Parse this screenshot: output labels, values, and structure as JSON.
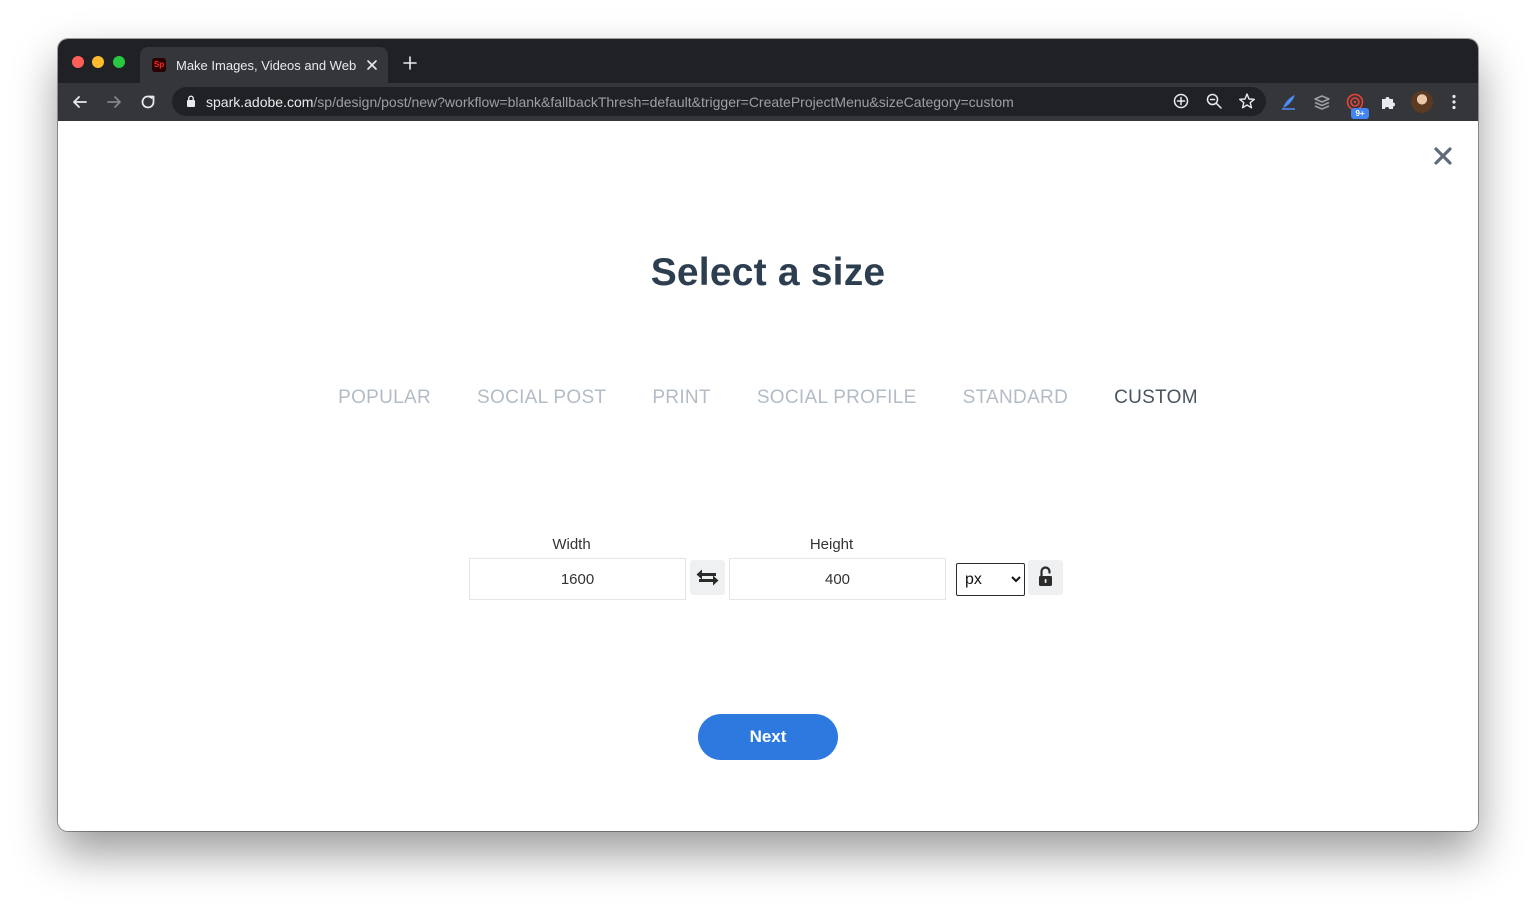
{
  "browser": {
    "tab": {
      "title": "Make Images, Videos and Web",
      "favicon_text": "Sp"
    },
    "url": {
      "host": "spark.adobe.com",
      "path": "/sp/design/post/new?workflow=blank&fallbackThresh=default&trigger=CreateProjectMenu&sizeCategory=custom"
    },
    "extension_badge": "9+"
  },
  "page": {
    "title": "Select a size",
    "tabs": [
      {
        "label": "POPULAR",
        "active": false
      },
      {
        "label": "SOCIAL POST",
        "active": false
      },
      {
        "label": "PRINT",
        "active": false
      },
      {
        "label": "SOCIAL PROFILE",
        "active": false
      },
      {
        "label": "STANDARD",
        "active": false
      },
      {
        "label": "CUSTOM",
        "active": true
      }
    ],
    "width": {
      "label": "Width",
      "value": "1600"
    },
    "height": {
      "label": "Height",
      "value": "400"
    },
    "unit": {
      "selected": "px"
    },
    "next_label": "Next"
  },
  "colors": {
    "primary": "#2d79e0",
    "heading": "#2c3e50",
    "tab_inactive": "#b3bcc6",
    "tab_active": "#4a5461"
  }
}
